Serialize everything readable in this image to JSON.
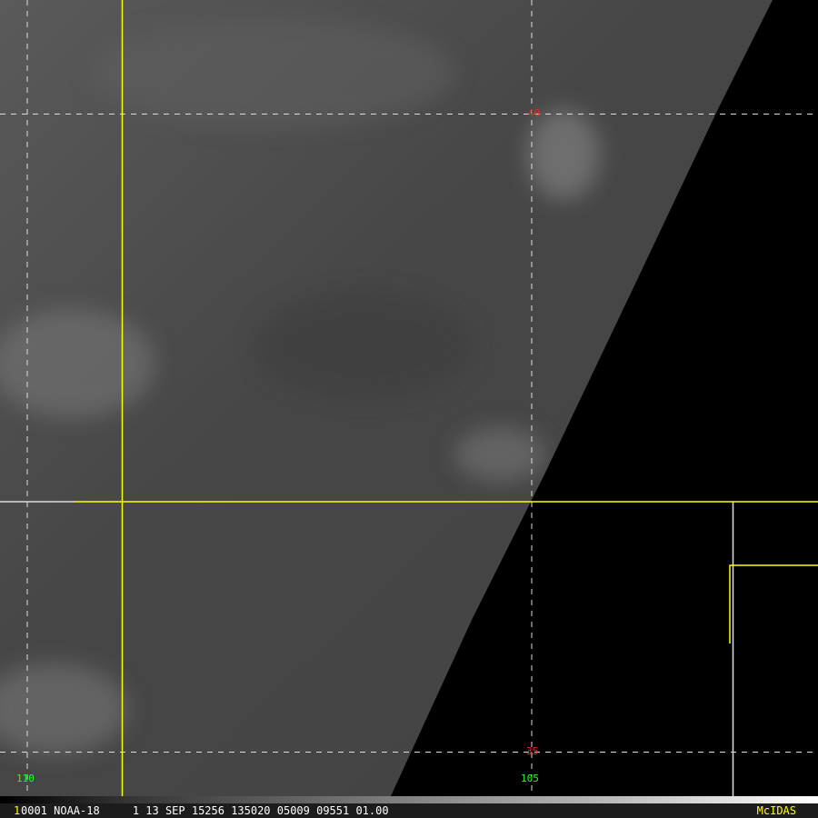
{
  "map": {
    "lat_labels": [
      "40",
      "35"
    ],
    "lon_labels": [
      "110",
      "105"
    ],
    "lat_color": "#ff2020",
    "lon_color": "#20ff20",
    "border_color": "#ffff00"
  },
  "status": {
    "frame": "1",
    "info": "0001 NOAA-18     1 13 SEP 15256 135020 05009 09551 01.00",
    "brand": "McIDAS"
  }
}
